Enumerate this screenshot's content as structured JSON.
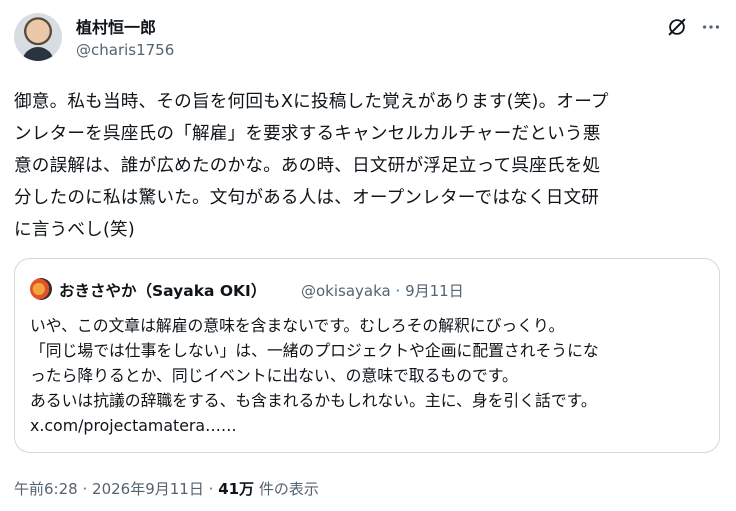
{
  "author": {
    "name": "植村恒一郎",
    "handle": "@charis1756"
  },
  "tweet": {
    "text": "御意。私も当時、その旨を何回もXに投稿した覚えがあります(笑)。オープ\nンレターを呉座氏の「解雇」を要求するキャンセルカルチャーだという悪\n意の誤解は、誰が広めたのかな。あの時、日文研が浮足立って呉座氏を処\n分したのに私は驚いた。文句がある人は、オープンレターではなく日文研\nに言うべし(笑)"
  },
  "quote": {
    "name": "おきさやか（Sayaka OKI）",
    "handle": "@okisayaka",
    "separator": "·",
    "date": "9月11日",
    "text": "いや、この文章は解雇の意味を含まないです。むしろその解釈にびっくり。\n「同じ場では仕事をしない」は、一緒のプロジェクトや企画に配置されそうにな\nったら降りるとか、同じイベントに出ない、の意味で取るものです。\nあるいは抗議の辞職をする、も含まれるかもしれない。主に、身を引く話です。\nx.com/projectamatera……"
  },
  "footer": {
    "time": "午前6:28",
    "sep1": "·",
    "date": "2026年9月11日",
    "sep2": "·",
    "views_count": "41万",
    "views_label": "件の表示"
  },
  "icons": {
    "grok": "grok-icon",
    "more": "more-icon"
  }
}
